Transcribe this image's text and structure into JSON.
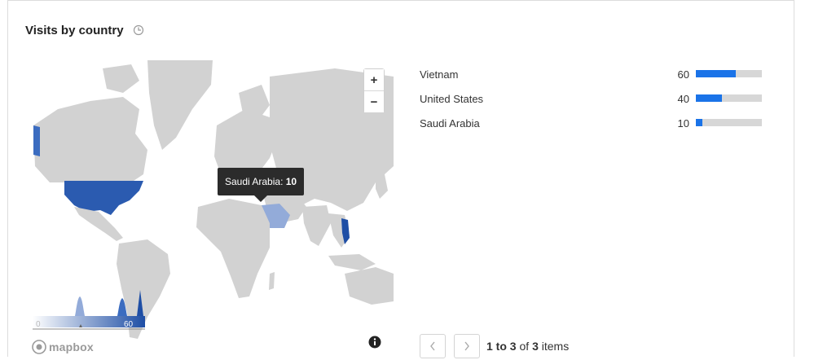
{
  "widget": {
    "title": "Visits by country",
    "title_icon": "clock-icon"
  },
  "map": {
    "zoom_in_label": "+",
    "zoom_out_label": "−",
    "tooltip": {
      "country": "Saudi Arabia",
      "separator": ": ",
      "value": "10"
    },
    "legend": {
      "min": "0",
      "max": "60"
    },
    "attribution": "mapbox",
    "colors": {
      "land": "#d2d2d2",
      "high": "#2b5bb0",
      "mid": "#3b6cc0",
      "low": "#93abd9",
      "vietnam": "#1e4ea5"
    }
  },
  "countries": [
    {
      "name": "Vietnam",
      "visits": "60",
      "share": 0.6
    },
    {
      "name": "United States",
      "visits": "40",
      "share": 0.4
    },
    {
      "name": "Saudi Arabia",
      "visits": "10",
      "share": 0.1
    }
  ],
  "pagination": {
    "from": "1",
    "to_word": " to ",
    "to": "3",
    "of_word": " of ",
    "total": "3",
    "items_word": " items"
  },
  "accent_color": "#1a73e8"
}
